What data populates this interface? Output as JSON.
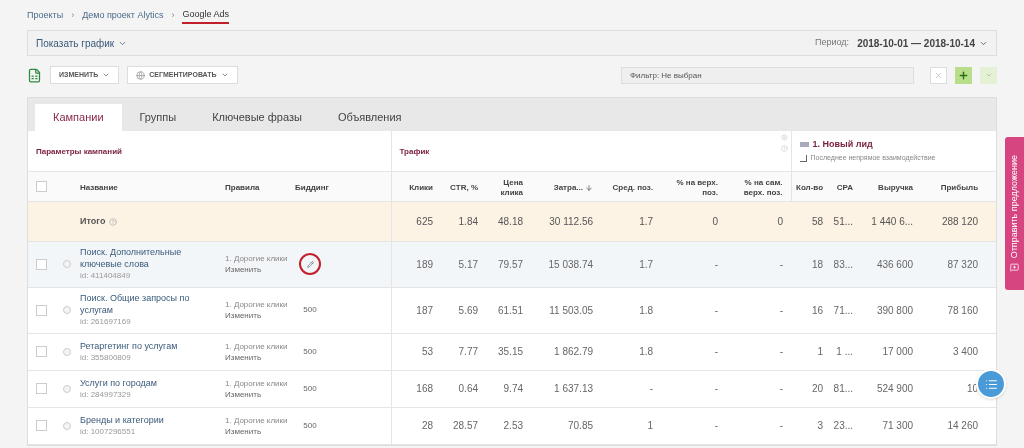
{
  "breadcrumb_separator": "›",
  "select_all_checked": false,
  "breadcrumbs": [
    {
      "label": "Проекты",
      "current": false,
      "underlined": false
    },
    {
      "label": "Демо проект Alytics",
      "current": false,
      "underlined": false
    },
    {
      "label": "Google Ads",
      "current": true,
      "underlined": true
    }
  ],
  "chart_bar": {
    "toggle": "Показать график",
    "period_label": "Период:",
    "period_value": "2018-10-01 — 2018-10-14"
  },
  "toolbar": {
    "edit_button": "ИЗМЕНИТЬ",
    "segment_button": "СЕГМЕНТИРОВАТЬ",
    "filter": "Фильтр: Не выбран"
  },
  "tabs": [
    {
      "label": "Кампании",
      "selected": true
    },
    {
      "label": "Группы",
      "selected": false
    },
    {
      "label": "Ключевые фразы",
      "selected": false
    },
    {
      "label": "Объявления",
      "selected": false
    }
  ],
  "groups": {
    "params": "Параметры кампаний",
    "traffic": "Трафик",
    "conversion_title": "1. Новый лид",
    "conversion_subtitle": "Последнее непрямое взаимодействие"
  },
  "columns": [
    {
      "label": "Название",
      "sorted": false
    },
    {
      "label": "Правила",
      "sorted": false
    },
    {
      "label": "Биддинг",
      "sorted": false
    },
    {
      "label": "Клики",
      "sorted": false
    },
    {
      "label": "CTR, %",
      "sorted": false
    },
    {
      "label": "Цена клика",
      "sorted": false
    },
    {
      "label": "Затра...",
      "sorted": true
    },
    {
      "label": "Сред. поз.",
      "sorted": false
    },
    {
      "label": "% на верх. поз.",
      "sorted": false
    },
    {
      "label": "% на сам. верх. поз.",
      "sorted": false
    },
    {
      "label": "Кол-во",
      "sorted": false
    },
    {
      "label": "CPA",
      "sorted": false
    },
    {
      "label": "Выручка",
      "sorted": false
    },
    {
      "label": "Прибыль",
      "sorted": false
    }
  ],
  "total": {
    "label": "Итого",
    "values": [
      "625",
      "1.84",
      "48.18",
      "30 112.56",
      "1.7",
      "0",
      "0",
      "58",
      "51...",
      "1 440 6...",
      "288 120"
    ]
  },
  "rows": [
    {
      "name": "Поиск. Дополнительные ключевые слова",
      "id": "id: 411404849",
      "rule": "1. Дорогие клики",
      "rule_link": "Изменить",
      "bidding": {
        "kind": "edit"
      },
      "checked": false,
      "highlighted": true,
      "circled": true,
      "values": [
        "189",
        "5.17",
        "79.57",
        "15 038.74",
        "1.7",
        "-",
        "-",
        "18",
        "83...",
        "436 600",
        "87 320"
      ]
    },
    {
      "name": "Поиск. Общие запросы по услугам",
      "id": "id: 261697169",
      "rule": "1. Дорогие клики",
      "rule_link": "Изменить",
      "bidding": {
        "kind": "value",
        "text": "500"
      },
      "checked": false,
      "highlighted": false,
      "circled": false,
      "values": [
        "187",
        "5.69",
        "61.51",
        "11 503.05",
        "1.8",
        "-",
        "-",
        "16",
        "71...",
        "390 800",
        "78 160"
      ]
    },
    {
      "name": "Ретаргетинг по услугам",
      "id": "id: 355800809",
      "rule": "1. Дорогие клики",
      "rule_link": "Изменить",
      "bidding": {
        "kind": "value",
        "text": "500"
      },
      "checked": false,
      "highlighted": false,
      "circled": false,
      "values": [
        "53",
        "7.77",
        "35.15",
        "1 862.79",
        "1.8",
        "-",
        "-",
        "1",
        "1 ...",
        "17 000",
        "3 400"
      ]
    },
    {
      "name": "Услуги по городам",
      "id": "id: 284997329",
      "rule": "1. Дорогие клики",
      "rule_link": "Изменить",
      "bidding": {
        "kind": "value",
        "text": "500"
      },
      "checked": false,
      "highlighted": false,
      "circled": false,
      "values": [
        "168",
        "0.64",
        "9.74",
        "1 637.13",
        "-",
        "-",
        "-",
        "20",
        "81...",
        "524 900",
        "10"
      ]
    },
    {
      "name": "Бренды и категории",
      "id": "id: 1007296551",
      "rule": "1. Дорогие клики",
      "rule_link": "Изменить",
      "bidding": {
        "kind": "value",
        "text": "500"
      },
      "checked": false,
      "highlighted": false,
      "circled": false,
      "values": [
        "28",
        "28.57",
        "2.53",
        "70.85",
        "1",
        "-",
        "-",
        "3",
        "23...",
        "71 300",
        "14 260"
      ]
    }
  ],
  "side_tab": "Отправить предложение"
}
